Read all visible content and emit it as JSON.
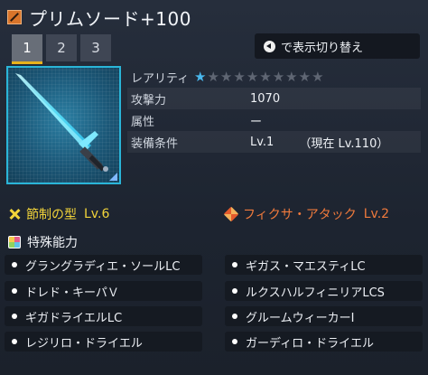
{
  "item": {
    "name": "プリムソード+100",
    "type_icon": "sword-icon",
    "rarity_stars": 1,
    "rarity_max": 10
  },
  "tabs": [
    "1",
    "2",
    "3"
  ],
  "active_tab": 0,
  "switch_button": {
    "icon": "circle-left-arrow-icon",
    "label": "で表示切り替え"
  },
  "stats": {
    "rarity_label": "レアリティ",
    "attack_label": "攻撃力",
    "attack_value": "1070",
    "element_label": "属性",
    "element_value": "ー",
    "req_label": "装備条件",
    "req_value": "Lv.1",
    "req_current": "（現在  Lv.110）"
  },
  "potentials": {
    "left": {
      "name": "節制の型",
      "level": "Lv.6",
      "color": "#f2d43a"
    },
    "right": {
      "name": "フィクサ・アタック",
      "level": "Lv.2",
      "color": "#f07a3c"
    }
  },
  "special": {
    "heading": "特殊能力",
    "abilities": [
      "グラングラディエ・ソールLC",
      "ギガス・マエスティLC",
      "ドレド・キーパＶ",
      "ルクスハルフィニリアLCS",
      "ギガドライエルLC",
      "グルームウィーカーⅠ",
      "レジリロ・ドライエル",
      "ガーディロ・ドライエル"
    ]
  },
  "colors": {
    "accent_tab": "#e8b21b",
    "frame": "#2ab5d8",
    "star_on": "#49b8ee"
  }
}
